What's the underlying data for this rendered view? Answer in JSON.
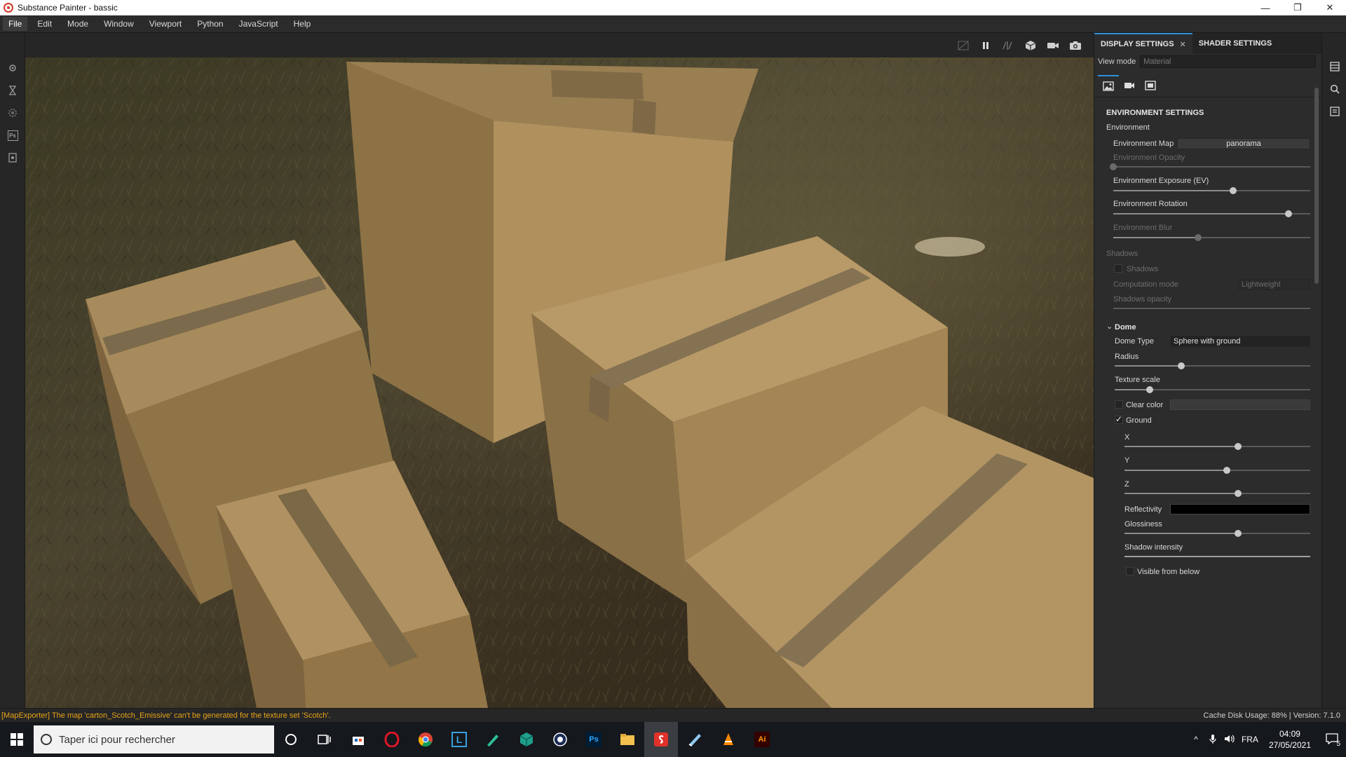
{
  "window": {
    "title": "Substance Painter - bassic",
    "minimize": "—",
    "maximize": "❐",
    "close": "✕"
  },
  "menu": [
    "File",
    "Edit",
    "Mode",
    "Window",
    "Viewport",
    "Python",
    "JavaScript",
    "Help"
  ],
  "left_tools": [
    "settings-icon",
    "hourglass-icon",
    "gear-icon",
    "photoshop-icon",
    "document-icon"
  ],
  "left_tools_ps": "Ps",
  "viewport_toolbar": [
    "no-image-icon",
    "pause-icon",
    "split-view-icon",
    "cube-icon",
    "camera-icon",
    "screenshot-icon"
  ],
  "panel": {
    "tab_display": "DISPLAY SETTINGS",
    "tab_close": "✕",
    "tab_shader": "SHADER SETTINGS",
    "view_mode_label": "View mode",
    "view_mode_value": "Material",
    "env": {
      "section": "ENVIRONMENT SETTINGS",
      "environment": "Environment",
      "map_label": "Environment Map",
      "map_value": "panorama",
      "opacity_label": "Environment Opacity",
      "opacity_level": 0.0,
      "exposure_label": "Environment Exposure (EV)",
      "exposure_level": 0.61,
      "rotation_label": "Environment Rotation",
      "rotation_level": 0.89,
      "blur_label": "Environment Blur",
      "blur_level": 0.43
    },
    "shadows": {
      "section": "Shadows",
      "shadows_label": "Shadows",
      "computation_label": "Computation mode",
      "computation_value": "Lightweight",
      "opacity_label": "Shadows opacity"
    },
    "dome": {
      "section": "Dome",
      "type_label": "Dome Type",
      "type_value": "Sphere with ground",
      "radius_label": "Radius",
      "radius_level": 0.34,
      "texture_scale_label": "Texture scale",
      "texture_scale_level": 0.18,
      "clear_color_label": "Clear color",
      "ground_label": "Ground",
      "x_label": "X",
      "x_level": 0.61,
      "y_label": "Y",
      "y_level": 0.55,
      "z_label": "Z",
      "z_level": 0.61,
      "reflectivity_label": "Reflectivity",
      "glossiness_label": "Glossiness",
      "glossiness_level": 0.61,
      "shadow_intensity_label": "Shadow intensity",
      "visible_below_label": "Visible from below"
    }
  },
  "status": {
    "message": "[MapExporter] The map 'carton_Scotch_Emissive' can't be generated for the texture set 'Scotch'.",
    "info": "Cache Disk Usage:   88%  |  Version: 7.1.0"
  },
  "taskbar": {
    "search_placeholder": "Taper ici pour rechercher",
    "apps": [
      "cortana-icon",
      "task-view-icon",
      "store-icon",
      "opera-icon",
      "chrome-icon",
      "app-L-icon",
      "pen-icon",
      "app-cube-icon",
      "app-circle-icon",
      "photoshop-icon",
      "folder-icon",
      "substance-icon",
      "app-blue-icon",
      "vlc-icon",
      "illustrator-icon"
    ],
    "ps_label": "Ps",
    "ai_label": "Ai",
    "l_label": "L",
    "lang": "FRA",
    "time": "04:09",
    "date": "27/05/2021",
    "notif_count": "5"
  },
  "colors": {
    "accent": "#2f8fd8",
    "status_warning": "#e8a417",
    "reflectivity": "#000000",
    "clear_color": "#3a3a3a"
  }
}
